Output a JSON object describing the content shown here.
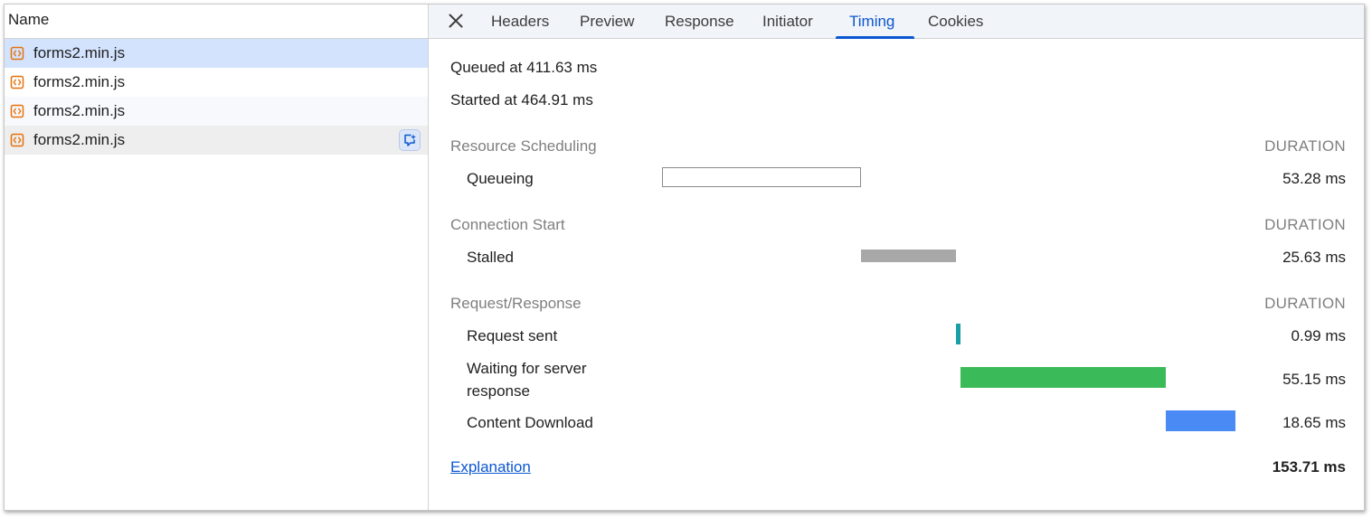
{
  "requests": {
    "header": "Name",
    "items": [
      {
        "name": "forms2.min.js"
      },
      {
        "name": "forms2.min.js"
      },
      {
        "name": "forms2.min.js"
      },
      {
        "name": "forms2.min.js"
      }
    ]
  },
  "tabs": {
    "items": [
      "Headers",
      "Preview",
      "Response",
      "Initiator",
      "Timing",
      "Cookies"
    ],
    "active": "Timing"
  },
  "timing": {
    "queued_at": "Queued at 411.63 ms",
    "started_at": "Started at 464.91 ms",
    "duration_label": "DURATION",
    "sections": [
      {
        "title": "Resource Scheduling",
        "phases": [
          {
            "label": "Queueing",
            "value": "53.28 ms",
            "start_ms": 411.63,
            "duration_ms": 53.28,
            "color": "#ffffff"
          }
        ]
      },
      {
        "title": "Connection Start",
        "phases": [
          {
            "label": "Stalled",
            "value": "25.63 ms",
            "start_ms": 464.91,
            "duration_ms": 25.63,
            "color": "#a8a8a8"
          }
        ]
      },
      {
        "title": "Request/Response",
        "phases": [
          {
            "label": "Request sent",
            "value": "0.99 ms",
            "start_ms": 490.54,
            "duration_ms": 0.99,
            "color": "#1a9fa8"
          },
          {
            "label": "Waiting for server response",
            "value": "55.15 ms",
            "start_ms": 491.53,
            "duration_ms": 55.15,
            "color": "#3bba5a"
          },
          {
            "label": "Content Download",
            "value": "18.65 ms",
            "start_ms": 546.68,
            "duration_ms": 18.65,
            "color": "#4a8af4"
          }
        ]
      }
    ],
    "explanation_link": "Explanation",
    "total": "153.71 ms"
  },
  "colors": {
    "accent": "#0b57d0",
    "selected_row": "#d3e3fd",
    "file_icon": "#e8710a"
  }
}
